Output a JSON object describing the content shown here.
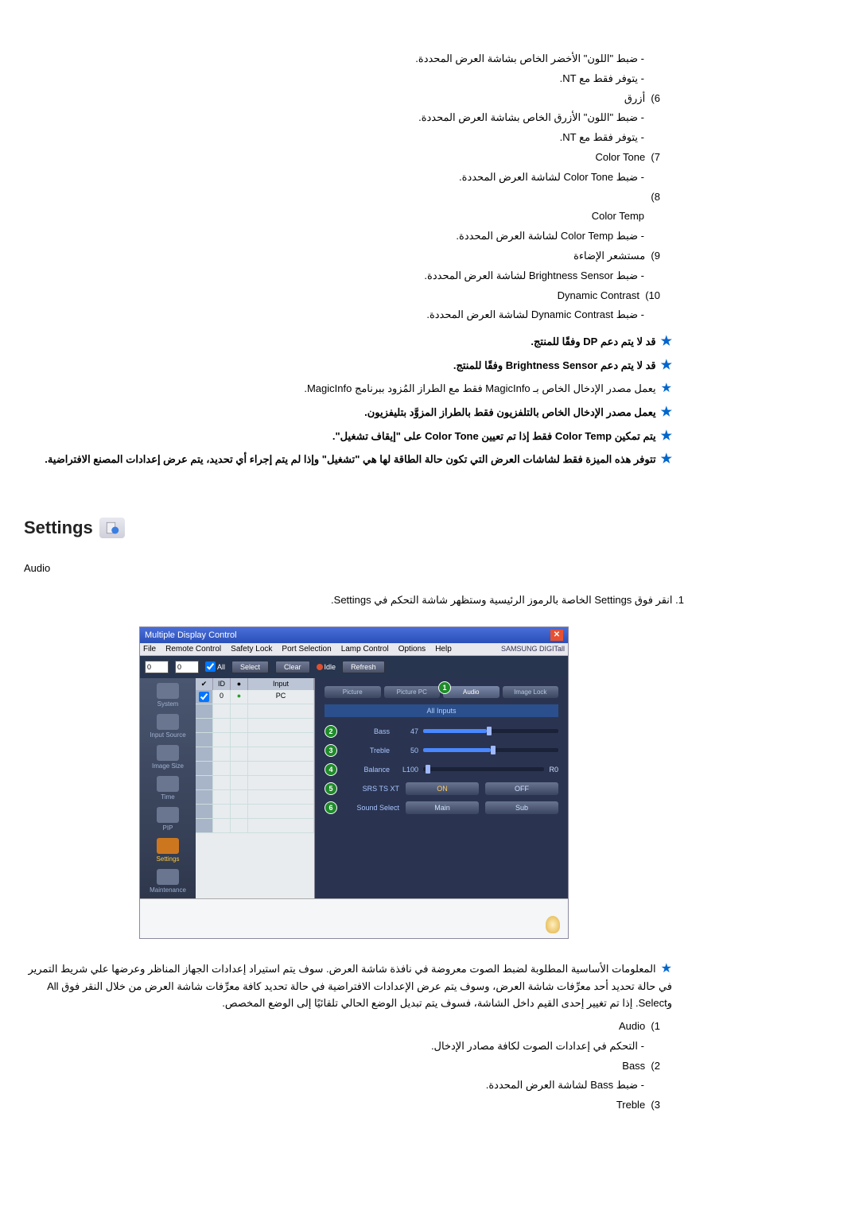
{
  "top_items": [
    {
      "type": "dash",
      "text": "ضبط \"اللون\" الأخضر الخاص بشاشة العرض المحددة."
    },
    {
      "type": "dash",
      "text": "يتوفر فقط مع NT."
    },
    {
      "type": "num",
      "num": "6)",
      "text": "أزرق"
    },
    {
      "type": "dash",
      "text": "ضبط \"اللون\" الأزرق الخاص بشاشة العرض المحددة."
    },
    {
      "type": "dash",
      "text": "يتوفر فقط مع NT."
    },
    {
      "type": "num",
      "num": "7)",
      "text": "Color Tone"
    },
    {
      "type": "dash",
      "text": "ضبط Color Tone لشاشة العرض المحددة."
    },
    {
      "type": "num",
      "num": "8)",
      "text": ""
    },
    {
      "type": "plain_indent",
      "text": "Color Temp"
    },
    {
      "type": "dash",
      "text": "ضبط Color Temp لشاشة العرض المحددة."
    },
    {
      "type": "num",
      "num": "9)",
      "text": "مستشعر الإضاءة"
    },
    {
      "type": "dash",
      "text": "ضبط Brightness Sensor لشاشة العرض المحددة."
    },
    {
      "type": "num",
      "num": "10)",
      "text": "Dynamic Contrast"
    },
    {
      "type": "dash",
      "text": "ضبط Dynamic Contrast لشاشة العرض المحددة."
    }
  ],
  "star_notes": [
    "قد لا يتم دعم DP وفقًا للمنتج.",
    "قد لا يتم دعم Brightness Sensor وفقًا للمنتج.",
    "يعمل مصدر الإدخال الخاص بـ MagicInfo فقط مع الطراز المُزود ببرنامج MagicInfo.",
    "يعمل مصدر الإدخال الخاص بالتلفزيون فقط بالطراز المزوَّد بتليفزيون.",
    "يتم تمكين Color Temp فقط إذا تم تعيين Color Tone على \"إيقاف تشغيل\".",
    "تتوفر هذه الميزة فقط لشاشات العرض التي تكون حالة الطاقة لها هي \"تشغيل\" وإذا لم يتم إجراء أي تحديد، يتم عرض إعدادات المصنع الافتراضية."
  ],
  "settings_title": "Settings",
  "audio_label": "Audio",
  "step_1": "1.  انقر فوق Settings الخاصة بالرموز الرئيسية وستظهر شاشة التحكم في Settings.",
  "dialog": {
    "title": "Multiple Display Control",
    "menus": [
      "File",
      "Remote Control",
      "Safety Lock",
      "Port Selection",
      "Lamp Control",
      "Options",
      "Help"
    ],
    "brand": "SAMSUNG DIGITall",
    "topbar": {
      "f1": "0",
      "f2": "0",
      "all": "All",
      "select": "Select",
      "clear": "Clear",
      "idle": "Idle",
      "refresh": "Refresh"
    },
    "sidebar": [
      "System",
      "Input Source",
      "Image Size",
      "Time",
      "PIP",
      "Settings",
      "Maintenance"
    ],
    "grid_head": [
      "",
      "ID",
      "",
      "Input"
    ],
    "grid_rows": [
      [
        "",
        "0",
        "",
        "PC"
      ]
    ],
    "tabs": [
      "Picture",
      "Picture PC",
      "Audio",
      "Image Lock"
    ],
    "all_inputs": "All Inputs",
    "sliders": [
      {
        "n": "2",
        "label": "Bass",
        "val": "47",
        "pct": 47,
        "right": ""
      },
      {
        "n": "3",
        "label": "Treble",
        "val": "50",
        "pct": 50,
        "right": ""
      },
      {
        "n": "4",
        "label": "Balance",
        "val": "L100",
        "pct": 2,
        "right": "R0"
      }
    ],
    "rows": [
      {
        "n": "5",
        "label": "SRS TS XT",
        "a": "ON",
        "b": "OFF"
      },
      {
        "n": "6",
        "label": "Sound Select",
        "a": "Main",
        "b": "Sub"
      }
    ],
    "audio_badge": "1"
  },
  "bottom_star": "المعلومات الأساسية المطلوبة لضبط الصوت معروضة في نافذة شاشة العرض. سوف يتم استيراد إعدادات الجهاز المناظر وعرضها علي شريط التمرير في حالة تحديد أحد معرِّفات شاشة العرض، وسوف يتم عرض الإعدادات الافتراضية في حالة تحديد كافة معرِّفات شاشة العرض من خلال النقر فوق All وSelect. إذا تم تغيير إحدى القيم داخل الشاشة، فسوف يتم تبديل الوضع الحالي تلقائيًا إلى الوضع المخصص.",
  "bottom_items": [
    {
      "num": "1)",
      "text": "Audio"
    },
    {
      "dash": "التحكم في إعدادات الصوت لكافة مصادر الإدخال."
    },
    {
      "num": "2)",
      "text": "Bass"
    },
    {
      "dash": "ضبط Bass لشاشة العرض المحددة."
    },
    {
      "num": "3)",
      "text": "Treble"
    }
  ]
}
